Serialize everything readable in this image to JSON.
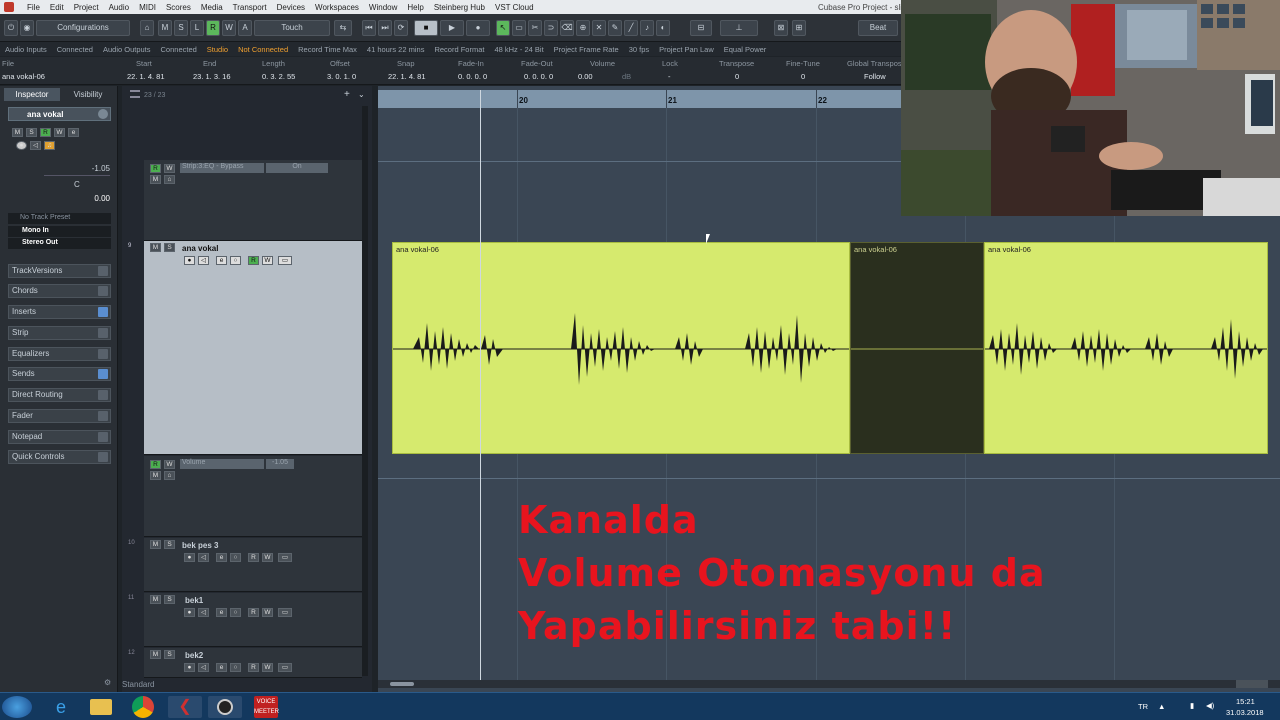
{
  "menubar": {
    "items": [
      "File",
      "Edit",
      "Project",
      "Audio",
      "MIDI",
      "Scores",
      "Media",
      "Transport",
      "Devices",
      "Workspaces",
      "Window",
      "Help",
      "Steinberg Hub",
      "VST Cloud"
    ],
    "title": "Cubase Pro Project - slin"
  },
  "toolbar": {
    "configurations": "Configurations",
    "automation_mode": "Touch",
    "grid_type": "Beat"
  },
  "statusbar": {
    "audio_inputs": "Audio Inputs",
    "audio_inputs_state": "Connected",
    "audio_outputs": "Audio Outputs",
    "audio_outputs_state": "Connected",
    "studio": "Studio",
    "studio_state": "Not Connected",
    "record_time_max": "Record Time Max",
    "record_time_value": "41 hours 22 mins",
    "record_format": "Record Format",
    "record_format_value": "48 kHz - 24 Bit",
    "frame_rate_label": "Project Frame Rate",
    "frame_rate_value": "30 fps",
    "pan_law_label": "Project Pan Law",
    "pan_law_value": "Equal Power"
  },
  "infoline": {
    "headers": [
      "File",
      "Start",
      "End",
      "Length",
      "Offset",
      "Snap",
      "Fade-In",
      "Fade-Out",
      "Volume",
      "Lock",
      "Transpose",
      "Fine-Tune",
      "Global Transpos"
    ],
    "values": [
      "ana vokal-06",
      "22. 1. 4. 81",
      "23. 1. 3. 16",
      "0. 3. 2. 55",
      "3. 0. 1. 0",
      "22. 1. 4. 81",
      "0. 0. 0. 0",
      "0. 0. 0. 0",
      "0.00",
      "-",
      "0",
      "0",
      "Follow"
    ],
    "volume_unit": "dB"
  },
  "inspector": {
    "tab_inspector": "Inspector",
    "tab_visibility": "Visibility",
    "track_name": "ana vokal",
    "volume_value": "-1.05",
    "pan_value": "C",
    "pan_value2": "0.00",
    "no_track_preset": "No Track Preset",
    "input": "Mono In",
    "output": "Stereo Out",
    "sections": [
      "TrackVersions",
      "Chords",
      "Inserts",
      "Strip",
      "Equalizers",
      "Sends",
      "Direct Routing",
      "Fader",
      "Notepad",
      "Quick Controls"
    ]
  },
  "tracklist": {
    "counter": "23 / 23",
    "tracks": [
      {
        "num": "9",
        "name": "ana vokal"
      },
      {
        "num": "10",
        "name": "bek pes 3"
      },
      {
        "num": "11",
        "name": "bek1"
      },
      {
        "num": "12",
        "name": "bek2"
      }
    ],
    "automation1_param": "Strip:3:EQ - Bypass",
    "automation1_value": "On",
    "automation2_param": "Volume",
    "automation2_value": "-1.05",
    "footer": "Standard"
  },
  "ruler": {
    "bars": [
      "20",
      "21",
      "22"
    ]
  },
  "events": [
    {
      "label": "ana vokal-06"
    },
    {
      "label": "ana vokal-06"
    },
    {
      "label": "ana vokal-06"
    }
  ],
  "overlay": {
    "line1": "Kanalda",
    "line2": "Volume Otomasyonu da",
    "line3": "Yapabilirsiniz tabi!!"
  },
  "taskbar": {
    "lang": "TR",
    "time": "15:21",
    "date": "31.03.2018",
    "voicemeeter": "VOICE MEETER"
  },
  "colors": {
    "event": "#d6ea6e",
    "overlay_text": "#e8141e",
    "ruler": "#7e95aa",
    "arrange_bg": "#3a4654"
  }
}
